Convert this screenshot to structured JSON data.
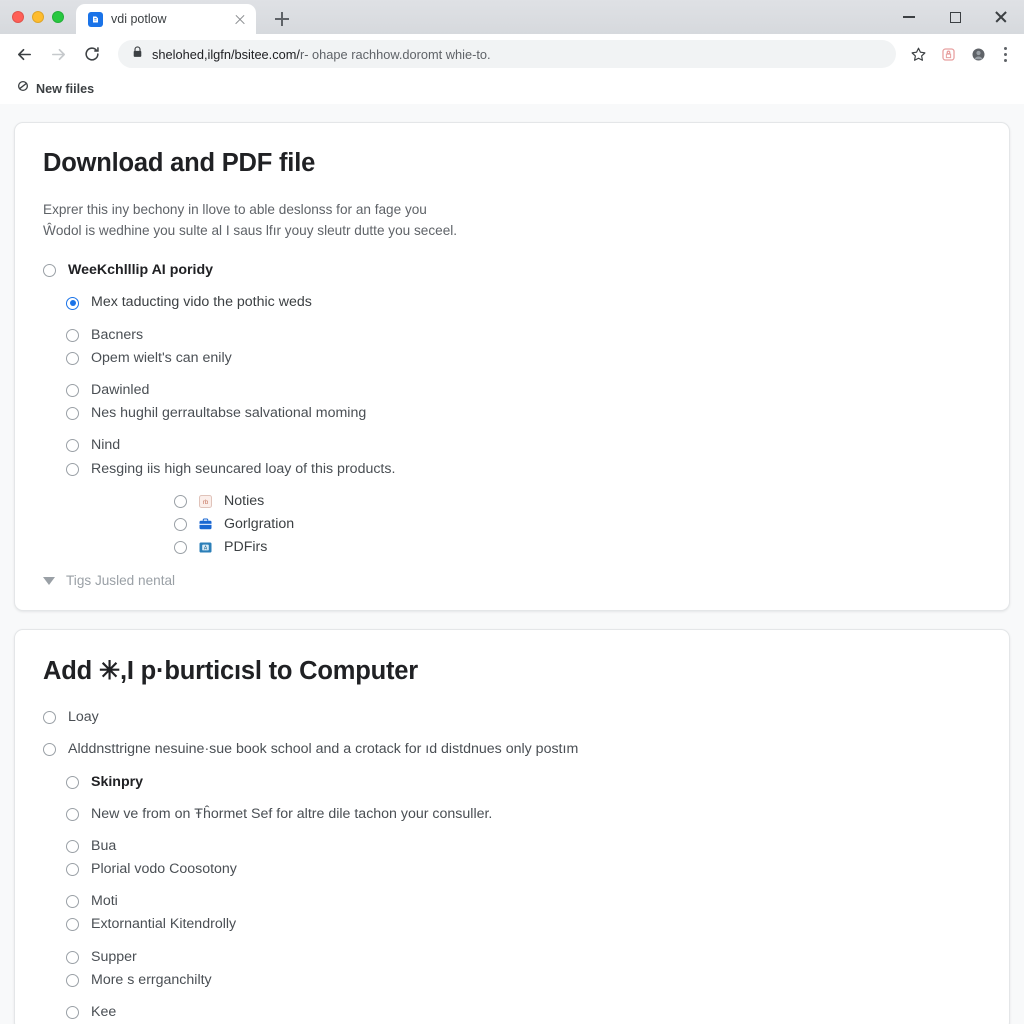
{
  "window": {
    "controls": {
      "minimize": "minimize-button",
      "maximize": "maximize-button",
      "close": "close-button"
    }
  },
  "tab": {
    "title": "vdi potlow",
    "favicon": "blue-document-favicon",
    "close_label": "×",
    "new_tab_label": "+"
  },
  "toolbar": {
    "back": "back-arrow-icon",
    "forward": "forward-arrow-icon",
    "reload": "reload-icon",
    "lock": "lock-icon",
    "url_strong": "shelohed,ilgfn/bsitee.com/",
    "url_dim": "r- ohape rachhow.doromt whie-to.",
    "bookmark_star": "star-icon",
    "extension": "extension-icon",
    "profile": "profile-avatar-icon",
    "menu": "three-dot-menu-icon"
  },
  "bookmarks_bar": {
    "items": [
      {
        "label": "New fiiles",
        "icon": "link-icon"
      }
    ]
  },
  "cards": [
    {
      "title": "Download and PDF file",
      "description_lines": [
        "Exprer this iny bechony in llove to able deslonss for an fage you",
        "Ŵodol is wedhine you sulte al I saus lfır youy sleutr dutte you seceel."
      ],
      "options": [
        {
          "label": "WeeKchlllip AI poridy",
          "indent": 0,
          "checked": false,
          "bold": true,
          "spacing": "gap-lg"
        },
        {
          "label": "Mex taducting vido the pothic weds",
          "indent": 1,
          "checked": true,
          "bold": false,
          "spacing": "gap-lg"
        },
        {
          "label": "Bacners",
          "indent": 1,
          "checked": false,
          "bold": false,
          "spacing": "tight"
        },
        {
          "label": "Opem wielt's can enily",
          "indent": 1,
          "checked": false,
          "bold": false,
          "spacing": "gap-lg"
        },
        {
          "label": "Dawinled",
          "indent": 1,
          "checked": false,
          "bold": false,
          "spacing": "tight"
        },
        {
          "label": "Nes hughil gerraultabse salvational moming",
          "indent": 1,
          "checked": false,
          "bold": false,
          "spacing": "gap-lg"
        },
        {
          "label": "Nind",
          "indent": 1,
          "checked": false,
          "bold": false,
          "spacing": "tight"
        },
        {
          "label": "Resging iis high seuncared loay of this products.",
          "indent": 1,
          "checked": false,
          "bold": false,
          "spacing": "gap-lg"
        }
      ],
      "icon_options": [
        {
          "label": "Noties",
          "icon": "notes-icon",
          "icon_color": "#f3d6cf",
          "checked": false
        },
        {
          "label": "Gorlgration",
          "icon": "briefcase-icon",
          "icon_color": "#1967d2",
          "checked": false
        },
        {
          "label": "PDFirs",
          "icon": "pdf-file-icon",
          "icon_color": "#2b7fb8",
          "checked": false
        }
      ],
      "disclosure": {
        "label": "Tigs Jusled nental",
        "icon": "triangle-down-icon"
      }
    },
    {
      "title": "Add ✳,I p·burticısl to Computer",
      "options": [
        {
          "label": "Loay",
          "indent": 0,
          "checked": false,
          "bold": false,
          "spacing": "gap-lg"
        },
        {
          "label": "Alddnsttrigne nesuine·sue book school and a crotack for ıd distdnues only postım",
          "indent": 0,
          "checked": false,
          "bold": false,
          "spacing": "gap-lg"
        },
        {
          "label": "Skinpry",
          "indent": 1,
          "checked": false,
          "bold": true,
          "spacing": "gap-lg"
        },
        {
          "label": "New ve from on Ŧĥormet Sef for altre dile tachon your consuller.",
          "indent": 1,
          "checked": false,
          "bold": false,
          "spacing": "gap-lg"
        },
        {
          "label": "Bua",
          "indent": 1,
          "checked": false,
          "bold": false,
          "spacing": "tight"
        },
        {
          "label": "Plorial vodo Coosotony",
          "indent": 1,
          "checked": false,
          "bold": false,
          "spacing": "gap-lg"
        },
        {
          "label": "Moti",
          "indent": 1,
          "checked": false,
          "bold": false,
          "spacing": "tight"
        },
        {
          "label": "Extornantial Kitendrolly",
          "indent": 1,
          "checked": false,
          "bold": false,
          "spacing": "gap-lg"
        },
        {
          "label": "Supper",
          "indent": 1,
          "checked": false,
          "bold": false,
          "spacing": "tight"
        },
        {
          "label": "More s errganchilty",
          "indent": 1,
          "checked": false,
          "bold": false,
          "spacing": "gap-lg"
        },
        {
          "label": "Kee",
          "indent": 1,
          "checked": false,
          "bold": false,
          "spacing": "tight"
        }
      ]
    }
  ],
  "colors": {
    "accent": "#1a73e8",
    "page_background": "#f8f9fa",
    "card_background": "#ffffff",
    "text_primary": "#202124",
    "text_secondary": "#5f6368"
  }
}
